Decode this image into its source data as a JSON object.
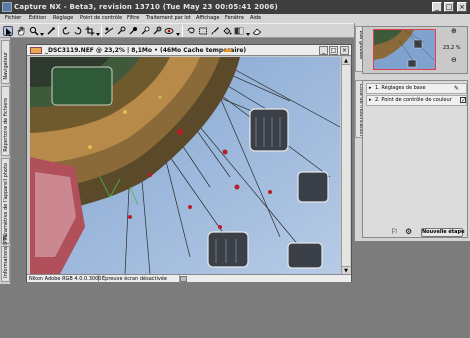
{
  "window": {
    "title": "Capture NX - Beta3, revision 13710 (Tue May 23 00:05:41     2006)"
  },
  "menu": [
    "Fichier",
    "Édition",
    "Réglage",
    "Point de contrôle",
    "Filtre",
    "Traitement par lot",
    "Affichage",
    "Fenêtre",
    "Aide"
  ],
  "toolbar": {
    "icons": [
      "select-arrow-icon",
      "hand-icon",
      "zoom-icon",
      "eyedropper-icon",
      "rotate-left-icon",
      "rotate-right-icon",
      "crop-icon",
      "straighten-icon",
      "color-point-icon",
      "black-point-icon",
      "white-point-icon",
      "neutral-point-icon",
      "red-eye-icon",
      "lasso-icon",
      "marquee-icon",
      "brush-icon",
      "fill-icon",
      "gradient-icon",
      "eraser-icon"
    ]
  },
  "left_panels": [
    "Navigateur",
    "Répertoire de fichiers",
    "Paramètres de l'appareil photo",
    "Informations IPTC"
  ],
  "image_window": {
    "title": "_DSC3119.NEF @ 23,2% | 8,1Mo • (46Mo Cache temporaire)",
    "status_profile": "Nikon Adobe RGB 4.0.0.3000",
    "status_proof": "Épreuve écran désactivée"
  },
  "right_panels": {
    "birdseye_tab": "Vue globale",
    "zoom_value": "23,2 %",
    "edit_list_tab": "Liste de modification",
    "steps": [
      {
        "number": "1.",
        "label": "Réglages de base"
      },
      {
        "number": "2.",
        "label": "Point de contrôle de couleur"
      }
    ],
    "new_step_label": "Nouvelle étape"
  },
  "colors": {
    "title_bar": "#3e3e3e",
    "chrome": "#d4d4d4",
    "desktop": "#7c7c7c",
    "sky": "#8fb0d8",
    "selection": "#e04050"
  }
}
